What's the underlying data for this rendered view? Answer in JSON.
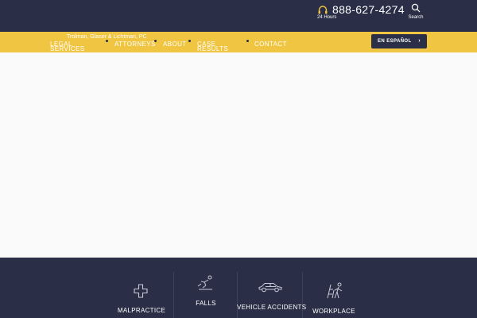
{
  "header": {
    "phone": "888-627-4274",
    "hours": "24 Hours",
    "search_label": "Search",
    "headset_icon": "headset-icon",
    "search_icon": "search-icon"
  },
  "nav": {
    "firm_name": "Trolman, Glaser & Lichtman, PC",
    "items": [
      "Legal Services",
      "Attorneys",
      "About",
      "Case Results",
      "Contact"
    ],
    "language_button": "EN ESPAÑOL",
    "language_chevron": "›"
  },
  "practice_areas": [
    {
      "label": "MALPRACTICE",
      "icon": "medical-cross-icon"
    },
    {
      "label": "FALLS",
      "icon": "falling-person-icon"
    },
    {
      "label": "VEHICLE ACCIDENTS",
      "icon": "car-icon"
    },
    {
      "label": "WORKPLACE",
      "icon": "workplace-injury-icon"
    }
  ],
  "colors": {
    "navy": "#2a2f47",
    "gold": "#f0c542",
    "hero": "#fafafa",
    "icon_stroke": "#c8cad6"
  }
}
